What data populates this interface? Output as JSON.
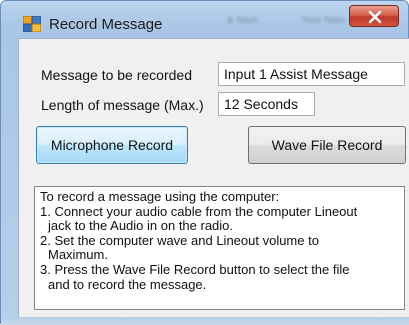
{
  "window": {
    "title": "Record Message",
    "close_icon": "close-icon",
    "app_icon": "record-app-icon",
    "background_hints": [
      "& Nam",
      "Your Nam"
    ]
  },
  "form": {
    "message_label": "Message to be recorded",
    "message_value": "Input 1 Assist Message",
    "length_label": "Length of message (Max.)",
    "length_value": "12 Seconds"
  },
  "buttons": {
    "microphone_record": "Microphone Record",
    "wave_file_record": "Wave File Record"
  },
  "instructions": {
    "lines": [
      "To record a message using the computer:",
      "1. Connect your audio cable from the computer Lineout",
      "    jack to the Audio in on the radio.",
      "2. Set the computer wave and Lineout volume to",
      "    Maximum.",
      "3. Press the Wave File Record button to select the file",
      "    and to record the message."
    ]
  },
  "colors": {
    "title_bar": "#a9c6e6",
    "close_button": "#c0392b",
    "dialog_bg": "#f0f0f0",
    "focused_button": "#bee6fd"
  }
}
